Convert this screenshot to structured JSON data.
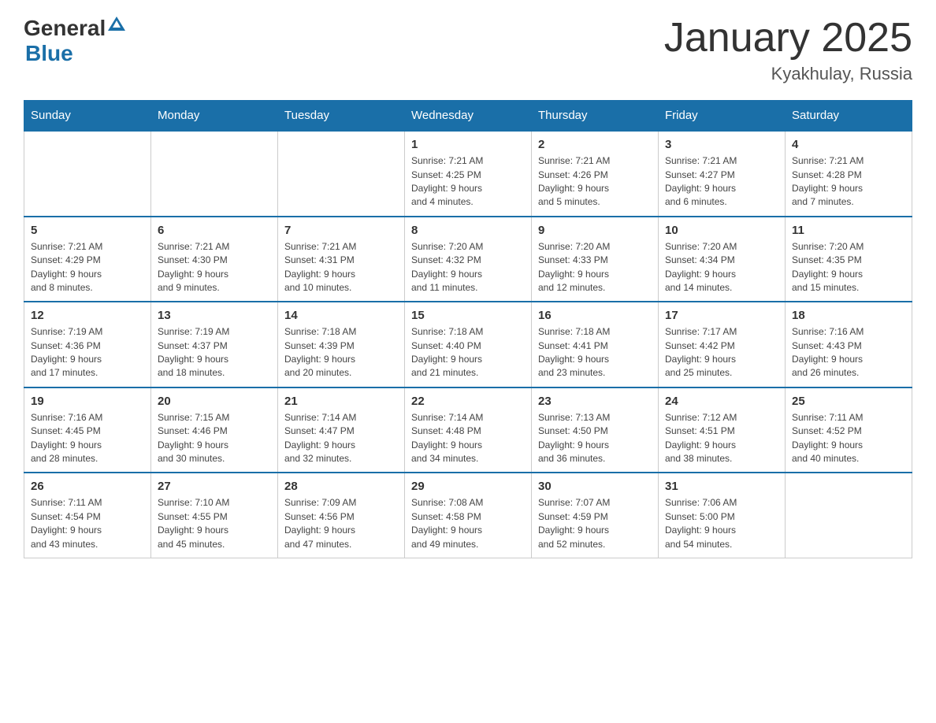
{
  "header": {
    "logo_general": "General",
    "logo_blue": "Blue",
    "title": "January 2025",
    "subtitle": "Kyakhulay, Russia"
  },
  "columns": [
    "Sunday",
    "Monday",
    "Tuesday",
    "Wednesday",
    "Thursday",
    "Friday",
    "Saturday"
  ],
  "weeks": [
    [
      {
        "day": "",
        "info": ""
      },
      {
        "day": "",
        "info": ""
      },
      {
        "day": "",
        "info": ""
      },
      {
        "day": "1",
        "info": "Sunrise: 7:21 AM\nSunset: 4:25 PM\nDaylight: 9 hours\nand 4 minutes."
      },
      {
        "day": "2",
        "info": "Sunrise: 7:21 AM\nSunset: 4:26 PM\nDaylight: 9 hours\nand 5 minutes."
      },
      {
        "day": "3",
        "info": "Sunrise: 7:21 AM\nSunset: 4:27 PM\nDaylight: 9 hours\nand 6 minutes."
      },
      {
        "day": "4",
        "info": "Sunrise: 7:21 AM\nSunset: 4:28 PM\nDaylight: 9 hours\nand 7 minutes."
      }
    ],
    [
      {
        "day": "5",
        "info": "Sunrise: 7:21 AM\nSunset: 4:29 PM\nDaylight: 9 hours\nand 8 minutes."
      },
      {
        "day": "6",
        "info": "Sunrise: 7:21 AM\nSunset: 4:30 PM\nDaylight: 9 hours\nand 9 minutes."
      },
      {
        "day": "7",
        "info": "Sunrise: 7:21 AM\nSunset: 4:31 PM\nDaylight: 9 hours\nand 10 minutes."
      },
      {
        "day": "8",
        "info": "Sunrise: 7:20 AM\nSunset: 4:32 PM\nDaylight: 9 hours\nand 11 minutes."
      },
      {
        "day": "9",
        "info": "Sunrise: 7:20 AM\nSunset: 4:33 PM\nDaylight: 9 hours\nand 12 minutes."
      },
      {
        "day": "10",
        "info": "Sunrise: 7:20 AM\nSunset: 4:34 PM\nDaylight: 9 hours\nand 14 minutes."
      },
      {
        "day": "11",
        "info": "Sunrise: 7:20 AM\nSunset: 4:35 PM\nDaylight: 9 hours\nand 15 minutes."
      }
    ],
    [
      {
        "day": "12",
        "info": "Sunrise: 7:19 AM\nSunset: 4:36 PM\nDaylight: 9 hours\nand 17 minutes."
      },
      {
        "day": "13",
        "info": "Sunrise: 7:19 AM\nSunset: 4:37 PM\nDaylight: 9 hours\nand 18 minutes."
      },
      {
        "day": "14",
        "info": "Sunrise: 7:18 AM\nSunset: 4:39 PM\nDaylight: 9 hours\nand 20 minutes."
      },
      {
        "day": "15",
        "info": "Sunrise: 7:18 AM\nSunset: 4:40 PM\nDaylight: 9 hours\nand 21 minutes."
      },
      {
        "day": "16",
        "info": "Sunrise: 7:18 AM\nSunset: 4:41 PM\nDaylight: 9 hours\nand 23 minutes."
      },
      {
        "day": "17",
        "info": "Sunrise: 7:17 AM\nSunset: 4:42 PM\nDaylight: 9 hours\nand 25 minutes."
      },
      {
        "day": "18",
        "info": "Sunrise: 7:16 AM\nSunset: 4:43 PM\nDaylight: 9 hours\nand 26 minutes."
      }
    ],
    [
      {
        "day": "19",
        "info": "Sunrise: 7:16 AM\nSunset: 4:45 PM\nDaylight: 9 hours\nand 28 minutes."
      },
      {
        "day": "20",
        "info": "Sunrise: 7:15 AM\nSunset: 4:46 PM\nDaylight: 9 hours\nand 30 minutes."
      },
      {
        "day": "21",
        "info": "Sunrise: 7:14 AM\nSunset: 4:47 PM\nDaylight: 9 hours\nand 32 minutes."
      },
      {
        "day": "22",
        "info": "Sunrise: 7:14 AM\nSunset: 4:48 PM\nDaylight: 9 hours\nand 34 minutes."
      },
      {
        "day": "23",
        "info": "Sunrise: 7:13 AM\nSunset: 4:50 PM\nDaylight: 9 hours\nand 36 minutes."
      },
      {
        "day": "24",
        "info": "Sunrise: 7:12 AM\nSunset: 4:51 PM\nDaylight: 9 hours\nand 38 minutes."
      },
      {
        "day": "25",
        "info": "Sunrise: 7:11 AM\nSunset: 4:52 PM\nDaylight: 9 hours\nand 40 minutes."
      }
    ],
    [
      {
        "day": "26",
        "info": "Sunrise: 7:11 AM\nSunset: 4:54 PM\nDaylight: 9 hours\nand 43 minutes."
      },
      {
        "day": "27",
        "info": "Sunrise: 7:10 AM\nSunset: 4:55 PM\nDaylight: 9 hours\nand 45 minutes."
      },
      {
        "day": "28",
        "info": "Sunrise: 7:09 AM\nSunset: 4:56 PM\nDaylight: 9 hours\nand 47 minutes."
      },
      {
        "day": "29",
        "info": "Sunrise: 7:08 AM\nSunset: 4:58 PM\nDaylight: 9 hours\nand 49 minutes."
      },
      {
        "day": "30",
        "info": "Sunrise: 7:07 AM\nSunset: 4:59 PM\nDaylight: 9 hours\nand 52 minutes."
      },
      {
        "day": "31",
        "info": "Sunrise: 7:06 AM\nSunset: 5:00 PM\nDaylight: 9 hours\nand 54 minutes."
      },
      {
        "day": "",
        "info": ""
      }
    ]
  ]
}
